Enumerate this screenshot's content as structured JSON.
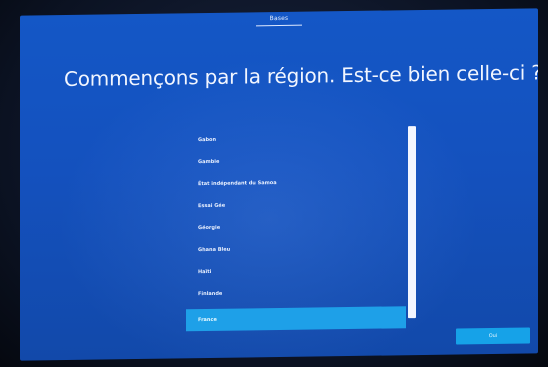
{
  "header": {
    "step_label": "Bases"
  },
  "main": {
    "title": "Commençons par la région. Est-ce bien celle-ci ?"
  },
  "region_list": {
    "items": [
      {
        "label": "Gabon"
      },
      {
        "label": "Gambie"
      },
      {
        "label": "État indépendant du Samoa"
      },
      {
        "label": "Essai Gée"
      },
      {
        "label": "Géorgie"
      },
      {
        "label": "Ghana Bleu"
      },
      {
        "label": "Haïti"
      },
      {
        "label": "Finlande"
      },
      {
        "label": "France"
      }
    ],
    "selected_index": 8,
    "scroll_position": 0.0
  },
  "footer": {
    "yes_button_label": "Oui"
  },
  "colors": {
    "background": "#1451be",
    "accent": "#1ea0e8",
    "text": "#f2f6ff"
  },
  "icons": {
    "corner": "accessibility-icon"
  }
}
